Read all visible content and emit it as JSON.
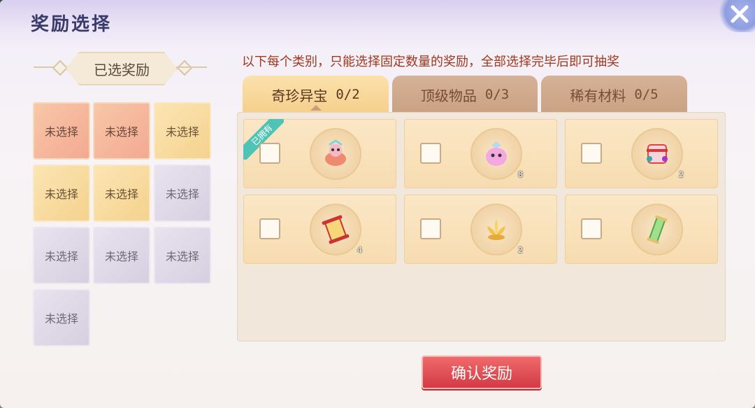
{
  "header": {
    "title": "奖励选择"
  },
  "selected": {
    "label": "已选奖励",
    "slots": [
      {
        "label": "未选择",
        "color": "pink"
      },
      {
        "label": "未选择",
        "color": "pink"
      },
      {
        "label": "未选择",
        "color": "yellow"
      },
      {
        "label": "未选择",
        "color": "yellow"
      },
      {
        "label": "未选择",
        "color": "yellow"
      },
      {
        "label": "未选择",
        "color": "purple"
      },
      {
        "label": "未选择",
        "color": "purple"
      },
      {
        "label": "未选择",
        "color": "purple"
      },
      {
        "label": "未选择",
        "color": "purple"
      },
      {
        "label": "未选择",
        "color": "purple"
      }
    ]
  },
  "hint": "以下每个类别，只能选择固定数量的奖励，全部选择完毕后即可抽奖",
  "tabs": [
    {
      "label": "奇珍异宝",
      "count": "0/2",
      "active": true
    },
    {
      "label": "顶级物品",
      "count": "0/3",
      "active": false
    },
    {
      "label": "稀有材料",
      "count": "0/5",
      "active": false
    }
  ],
  "items": [
    {
      "icon": "pink-ornament-icon",
      "qty": "",
      "owned": true
    },
    {
      "icon": "pink-creature-icon",
      "qty": "8",
      "owned": false
    },
    {
      "icon": "scroll-bundle-icon",
      "qty": "2",
      "owned": false
    },
    {
      "icon": "red-scroll-icon",
      "qty": "4",
      "owned": false
    },
    {
      "icon": "golden-lotus-icon",
      "qty": "2",
      "owned": false
    },
    {
      "icon": "green-scroll-icon",
      "qty": "",
      "owned": false
    }
  ],
  "owned_label": "已拥有",
  "confirm_label": "确认奖励",
  "colors": {
    "accent_red": "#d23a45",
    "hint_red": "#a1381e",
    "title": "#3b3a6c"
  }
}
